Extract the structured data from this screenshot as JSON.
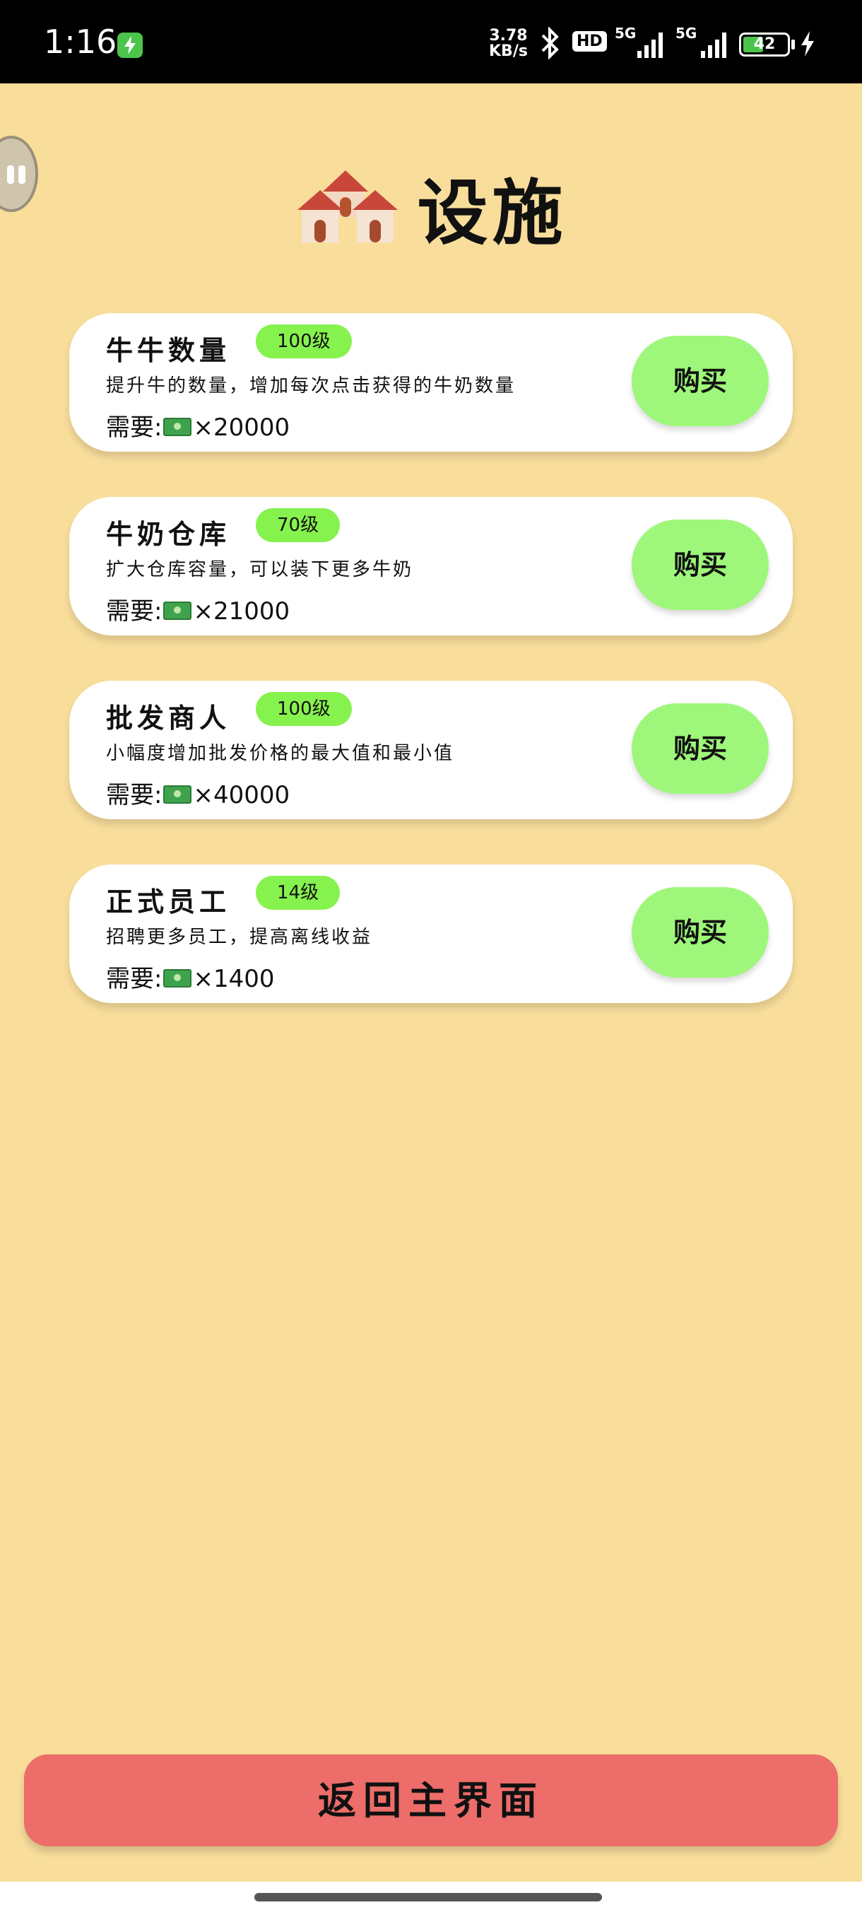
{
  "status_bar": {
    "time": "1:16",
    "net_speed_value": "3.78",
    "net_speed_unit": "KB/s",
    "hd_label": "HD",
    "signal1_label": "5G",
    "signal2_label": "5G",
    "battery_level": "42"
  },
  "title": "设施",
  "title_icon": "houses-icon",
  "cards": [
    {
      "name": "牛牛数量",
      "level": "100级",
      "description": "提升牛的数量，增加每次点击获得的牛奶数量",
      "cost_prefix": "需要:",
      "cost_amount": "×20000",
      "buy_label": "购买"
    },
    {
      "name": "牛奶仓库",
      "level": "70级",
      "description": "扩大仓库容量，可以装下更多牛奶",
      "cost_prefix": "需要:",
      "cost_amount": "×21000",
      "buy_label": "购买"
    },
    {
      "name": "批发商人",
      "level": "100级",
      "description": "小幅度增加批发价格的最大值和最小值",
      "cost_prefix": "需要:",
      "cost_amount": "×40000",
      "buy_label": "购买"
    },
    {
      "name": "正式员工",
      "level": "14级",
      "description": "招聘更多员工，提高离线收益",
      "cost_prefix": "需要:",
      "cost_amount": "×1400",
      "buy_label": "购买"
    }
  ],
  "return_button": "返回主界面",
  "colors": {
    "background": "#f8dd9b",
    "level_badge": "#86f24e",
    "buy_button": "#9ef77a",
    "return_button": "#ec6d69"
  }
}
